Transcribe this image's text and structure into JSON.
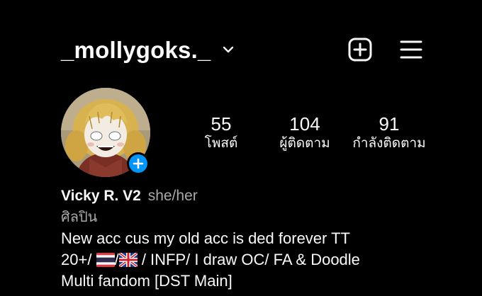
{
  "header": {
    "username": "_mollygoks._",
    "chevron_icon": "chevron-down-icon",
    "add_icon": "plus-square-icon",
    "menu_icon": "hamburger-menu-icon"
  },
  "profile": {
    "avatar_icon": "avatar",
    "add_story_icon": "plus-icon",
    "accent_color": "#0095f6"
  },
  "stats": {
    "posts_count": "55",
    "posts_label": "โพสต์",
    "followers_count": "104",
    "followers_label": "ผู้ติดตาม",
    "following_count": "91",
    "following_label": "กำลังติดตาม"
  },
  "bio": {
    "name": "Vicky R. V2",
    "pronouns": "she/her",
    "category": "ศิลปิน",
    "line1": "New acc cus my old acc is ded forever TT",
    "line2_prefix": "20+/",
    "line2_sep1": "/",
    "line2_suffix": "/ INFP/ I draw OC/ FA & Doodle",
    "line3": "Multi fandom [DST Main]",
    "flag1": "thailand-flag-icon",
    "flag2": "uk-flag-icon"
  }
}
